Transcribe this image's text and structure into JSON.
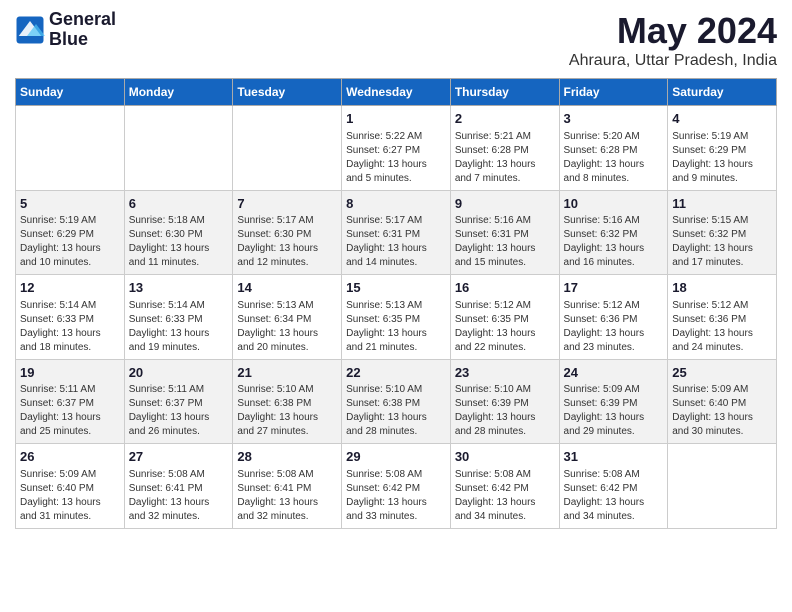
{
  "logo": {
    "line1": "General",
    "line2": "Blue"
  },
  "title": "May 2024",
  "subtitle": "Ahraura, Uttar Pradesh, India",
  "weekdays": [
    "Sunday",
    "Monday",
    "Tuesday",
    "Wednesday",
    "Thursday",
    "Friday",
    "Saturday"
  ],
  "weeks": [
    [
      {
        "day": "",
        "info": ""
      },
      {
        "day": "",
        "info": ""
      },
      {
        "day": "",
        "info": ""
      },
      {
        "day": "1",
        "info": "Sunrise: 5:22 AM\nSunset: 6:27 PM\nDaylight: 13 hours\nand 5 minutes."
      },
      {
        "day": "2",
        "info": "Sunrise: 5:21 AM\nSunset: 6:28 PM\nDaylight: 13 hours\nand 7 minutes."
      },
      {
        "day": "3",
        "info": "Sunrise: 5:20 AM\nSunset: 6:28 PM\nDaylight: 13 hours\nand 8 minutes."
      },
      {
        "day": "4",
        "info": "Sunrise: 5:19 AM\nSunset: 6:29 PM\nDaylight: 13 hours\nand 9 minutes."
      }
    ],
    [
      {
        "day": "5",
        "info": "Sunrise: 5:19 AM\nSunset: 6:29 PM\nDaylight: 13 hours\nand 10 minutes."
      },
      {
        "day": "6",
        "info": "Sunrise: 5:18 AM\nSunset: 6:30 PM\nDaylight: 13 hours\nand 11 minutes."
      },
      {
        "day": "7",
        "info": "Sunrise: 5:17 AM\nSunset: 6:30 PM\nDaylight: 13 hours\nand 12 minutes."
      },
      {
        "day": "8",
        "info": "Sunrise: 5:17 AM\nSunset: 6:31 PM\nDaylight: 13 hours\nand 14 minutes."
      },
      {
        "day": "9",
        "info": "Sunrise: 5:16 AM\nSunset: 6:31 PM\nDaylight: 13 hours\nand 15 minutes."
      },
      {
        "day": "10",
        "info": "Sunrise: 5:16 AM\nSunset: 6:32 PM\nDaylight: 13 hours\nand 16 minutes."
      },
      {
        "day": "11",
        "info": "Sunrise: 5:15 AM\nSunset: 6:32 PM\nDaylight: 13 hours\nand 17 minutes."
      }
    ],
    [
      {
        "day": "12",
        "info": "Sunrise: 5:14 AM\nSunset: 6:33 PM\nDaylight: 13 hours\nand 18 minutes."
      },
      {
        "day": "13",
        "info": "Sunrise: 5:14 AM\nSunset: 6:33 PM\nDaylight: 13 hours\nand 19 minutes."
      },
      {
        "day": "14",
        "info": "Sunrise: 5:13 AM\nSunset: 6:34 PM\nDaylight: 13 hours\nand 20 minutes."
      },
      {
        "day": "15",
        "info": "Sunrise: 5:13 AM\nSunset: 6:35 PM\nDaylight: 13 hours\nand 21 minutes."
      },
      {
        "day": "16",
        "info": "Sunrise: 5:12 AM\nSunset: 6:35 PM\nDaylight: 13 hours\nand 22 minutes."
      },
      {
        "day": "17",
        "info": "Sunrise: 5:12 AM\nSunset: 6:36 PM\nDaylight: 13 hours\nand 23 minutes."
      },
      {
        "day": "18",
        "info": "Sunrise: 5:12 AM\nSunset: 6:36 PM\nDaylight: 13 hours\nand 24 minutes."
      }
    ],
    [
      {
        "day": "19",
        "info": "Sunrise: 5:11 AM\nSunset: 6:37 PM\nDaylight: 13 hours\nand 25 minutes."
      },
      {
        "day": "20",
        "info": "Sunrise: 5:11 AM\nSunset: 6:37 PM\nDaylight: 13 hours\nand 26 minutes."
      },
      {
        "day": "21",
        "info": "Sunrise: 5:10 AM\nSunset: 6:38 PM\nDaylight: 13 hours\nand 27 minutes."
      },
      {
        "day": "22",
        "info": "Sunrise: 5:10 AM\nSunset: 6:38 PM\nDaylight: 13 hours\nand 28 minutes."
      },
      {
        "day": "23",
        "info": "Sunrise: 5:10 AM\nSunset: 6:39 PM\nDaylight: 13 hours\nand 28 minutes."
      },
      {
        "day": "24",
        "info": "Sunrise: 5:09 AM\nSunset: 6:39 PM\nDaylight: 13 hours\nand 29 minutes."
      },
      {
        "day": "25",
        "info": "Sunrise: 5:09 AM\nSunset: 6:40 PM\nDaylight: 13 hours\nand 30 minutes."
      }
    ],
    [
      {
        "day": "26",
        "info": "Sunrise: 5:09 AM\nSunset: 6:40 PM\nDaylight: 13 hours\nand 31 minutes."
      },
      {
        "day": "27",
        "info": "Sunrise: 5:08 AM\nSunset: 6:41 PM\nDaylight: 13 hours\nand 32 minutes."
      },
      {
        "day": "28",
        "info": "Sunrise: 5:08 AM\nSunset: 6:41 PM\nDaylight: 13 hours\nand 32 minutes."
      },
      {
        "day": "29",
        "info": "Sunrise: 5:08 AM\nSunset: 6:42 PM\nDaylight: 13 hours\nand 33 minutes."
      },
      {
        "day": "30",
        "info": "Sunrise: 5:08 AM\nSunset: 6:42 PM\nDaylight: 13 hours\nand 34 minutes."
      },
      {
        "day": "31",
        "info": "Sunrise: 5:08 AM\nSunset: 6:42 PM\nDaylight: 13 hours\nand 34 minutes."
      },
      {
        "day": "",
        "info": ""
      }
    ]
  ]
}
